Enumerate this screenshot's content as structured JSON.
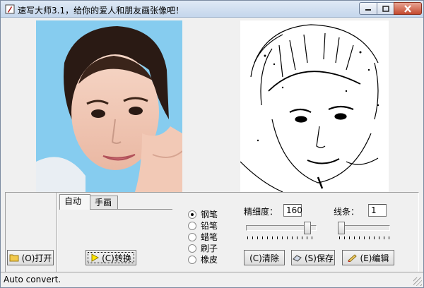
{
  "window": {
    "title": "速写大师3.1，给你的爱人和朋友画张像吧！",
    "accent": "#c4d6ec",
    "close_color": "#c44a2f"
  },
  "tabs": [
    {
      "label": "自动",
      "active": true
    },
    {
      "label": "手画",
      "active": false
    }
  ],
  "buttons": {
    "open": "(O)打开",
    "convert": "(C)转换",
    "clear": "(C)清除",
    "save": "(S)保存",
    "edit": "(E)编辑"
  },
  "tools": [
    {
      "label": "钢笔",
      "selected": true
    },
    {
      "label": "铅笔",
      "selected": false
    },
    {
      "label": "蜡笔",
      "selected": false
    },
    {
      "label": "刷子",
      "selected": false
    },
    {
      "label": "橡皮",
      "selected": false
    }
  ],
  "settings": {
    "detail_label": "精细度：",
    "detail_value": "160",
    "line_label": "线条：",
    "line_value": "1"
  },
  "status": {
    "text": "Auto convert."
  },
  "icons": [
    "app-icon",
    "minimize-icon",
    "maximize-icon",
    "close-icon",
    "folder-icon",
    "play-arrow-icon",
    "eraser-icon",
    "save-icon",
    "edit-icon"
  ]
}
